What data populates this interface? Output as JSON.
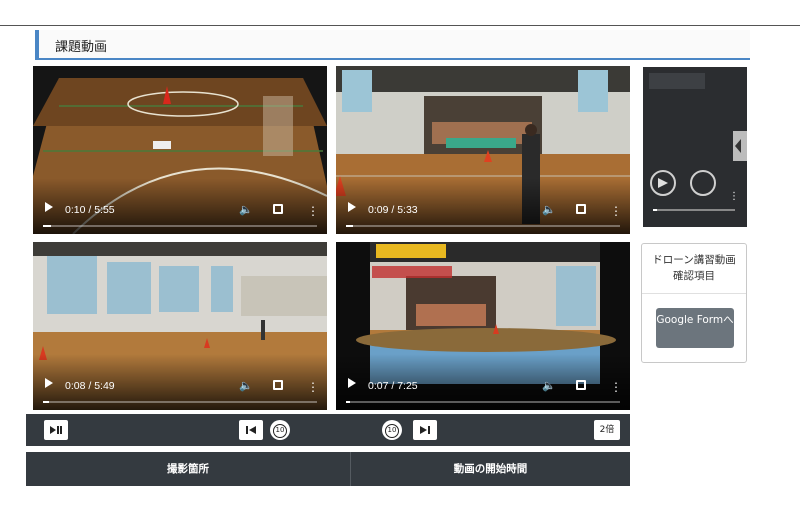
{
  "section": {
    "title": "課題動画"
  },
  "videos": [
    {
      "time": "0:10 / 5:55",
      "progress": 0.028
    },
    {
      "time": "0:09 / 5:33",
      "progress": 0.027
    },
    {
      "time": "0:08 / 5:49",
      "progress": 0.023
    },
    {
      "time": "0:07 / 7:25",
      "progress": 0.016
    }
  ],
  "side_card": {
    "title": "ドローン講習動画確認項目",
    "button_label": "Google Formへ"
  },
  "toolbar": {
    "speed_label": "2倍",
    "rewind_label": "10",
    "forward_label": "10"
  },
  "table_header": {
    "col1": "撮影箇所",
    "col2": "動画の開始時間"
  },
  "colors": {
    "accent": "#4a86c5",
    "toolbar_bg": "#343a40",
    "button_gray": "#6c757d"
  }
}
